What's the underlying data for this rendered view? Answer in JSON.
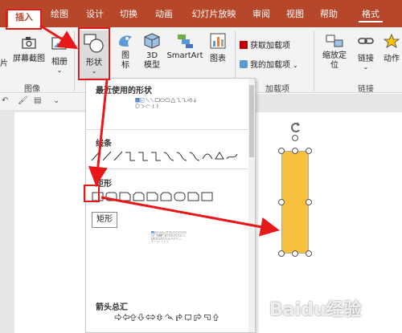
{
  "tabs": [
    "插入",
    "绘图",
    "设计",
    "切换",
    "动画",
    "幻灯片放映",
    "审阅",
    "视图",
    "帮助",
    "格式"
  ],
  "ribbon": {
    "screenshot_label": "屏幕截图",
    "album_label": "相册",
    "shapes_label": "形状",
    "icons_label": "图\n标",
    "model3d_label": "3D\n模型",
    "smartart_label": "SmartArt",
    "chart_label": "图表",
    "get_addins": "获取加载项",
    "my_addins": "我的加载项",
    "zoom_label": "缩放定\n位",
    "link_label": "链接",
    "action_label": "动作",
    "group_images": "图像",
    "group_addins": "加载项",
    "group_links": "链接",
    "left_label": "片"
  },
  "panel": {
    "recent": "最近使用的形状",
    "lines": "线条",
    "rects": "矩形",
    "basic": "基本形状",
    "basic_visible": "状",
    "arrows": "箭头总汇"
  },
  "tooltip": "矩形",
  "watermark": "Baidu经验",
  "colors": {
    "brand": "#b7472a",
    "highlight": "#e8181a",
    "shape_fill": "#f9c03e"
  }
}
